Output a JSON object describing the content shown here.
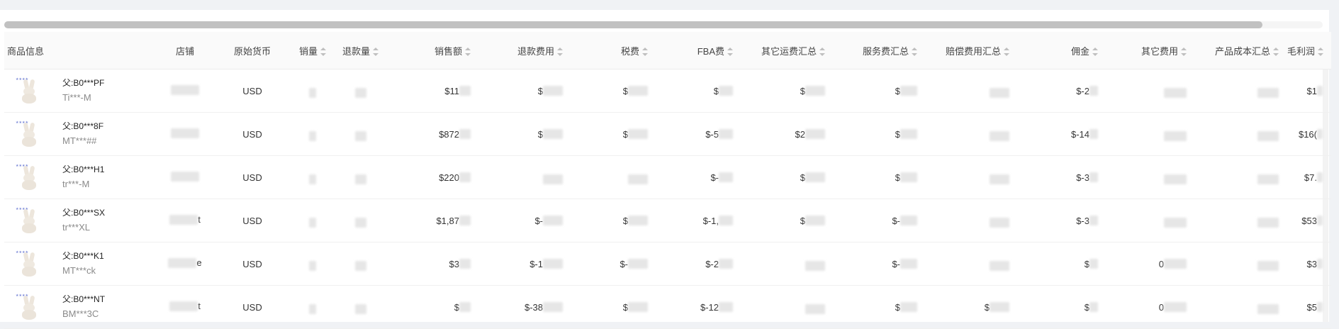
{
  "table": {
    "columns": [
      {
        "key": "product",
        "label": "商品信息",
        "align": "left",
        "sortable": false
      },
      {
        "key": "store",
        "label": "店铺",
        "align": "center",
        "sortable": false
      },
      {
        "key": "currency",
        "label": "原始货币",
        "align": "center",
        "sortable": false
      },
      {
        "key": "qty",
        "label": "销量",
        "align": "center",
        "sortable": true
      },
      {
        "key": "refund_qty",
        "label": "退款量",
        "align": "center",
        "sortable": true
      },
      {
        "key": "sales",
        "label": "销售额",
        "align": "right",
        "sortable": true
      },
      {
        "key": "refund_fee",
        "label": "退款费用",
        "align": "right",
        "sortable": true
      },
      {
        "key": "tax",
        "label": "税费",
        "align": "right",
        "sortable": true
      },
      {
        "key": "fba",
        "label": "FBA费",
        "align": "right",
        "sortable": true
      },
      {
        "key": "other_ship",
        "label": "其它运费汇总",
        "align": "right",
        "sortable": true
      },
      {
        "key": "service",
        "label": "服务费汇总",
        "align": "right",
        "sortable": true
      },
      {
        "key": "compensation",
        "label": "赔偿费用汇总",
        "align": "right",
        "sortable": true
      },
      {
        "key": "commission",
        "label": "佣金",
        "align": "right",
        "sortable": true
      },
      {
        "key": "other_fee",
        "label": "其它费用",
        "align": "right",
        "sortable": true
      },
      {
        "key": "cost",
        "label": "产品成本汇总",
        "align": "right",
        "sortable": true
      },
      {
        "key": "profit",
        "label": "毛利润",
        "align": "right",
        "sortable": true
      }
    ],
    "rows": [
      {
        "product": {
          "parent": "父:B0***PF",
          "sku": "Ti***-M"
        },
        "store": "",
        "currency": "USD",
        "qty": "",
        "refund_qty": "",
        "sales": "$11",
        "refund_fee": "$",
        "tax": "$",
        "fba": "$",
        "other_ship": "$",
        "service": "$",
        "compensation": "",
        "commission": "$-2",
        "other_fee": "",
        "cost": "",
        "profit": "$1"
      },
      {
        "product": {
          "parent": "父:B0***8F",
          "sku": "MT***##"
        },
        "store": "",
        "currency": "USD",
        "qty": "",
        "refund_qty": "",
        "sales": "$872",
        "refund_fee": "$",
        "tax": "$",
        "fba": "$-5",
        "other_ship": "$2",
        "service": "$",
        "compensation": "",
        "commission": "$-14",
        "other_fee": "",
        "cost": "",
        "profit": "$16("
      },
      {
        "product": {
          "parent": "父:B0***H1",
          "sku": "tr***-M"
        },
        "store": "",
        "currency": "USD",
        "qty": "",
        "refund_qty": "",
        "sales": "$220",
        "refund_fee": "",
        "tax": "",
        "fba": "$-",
        "other_ship": "$",
        "service": "$",
        "compensation": "",
        "commission": "$-3",
        "other_fee": "",
        "cost": "",
        "profit": "$7."
      },
      {
        "product": {
          "parent": "父:B0***SX",
          "sku": "tr***XL"
        },
        "store": "t",
        "currency": "USD",
        "qty": "",
        "refund_qty": "",
        "sales": "$1,87",
        "refund_fee": "$-",
        "tax": "$",
        "fba": "$-1,",
        "other_ship": "$",
        "service": "$-",
        "compensation": "",
        "commission": "$-3",
        "other_fee": "",
        "cost": "",
        "profit": "$53"
      },
      {
        "product": {
          "parent": "父:B0***K1",
          "sku": "MT***ck"
        },
        "store": "e",
        "currency": "USD",
        "qty": "",
        "refund_qty": "",
        "sales": "$3",
        "refund_fee": "$-1",
        "tax": "$-",
        "fba": "$-2",
        "other_ship": "",
        "service": "$-",
        "compensation": "",
        "commission": "$",
        "other_fee": "0",
        "cost": "",
        "profit": "$3"
      },
      {
        "product": {
          "parent": "父:B0***NT",
          "sku": "BM***3C"
        },
        "store": "t",
        "currency": "USD",
        "qty": "",
        "refund_qty": "",
        "sales": "$",
        "refund_fee": "$-38",
        "tax": "$",
        "fba": "$-12",
        "other_ship": "",
        "service": "$",
        "compensation": "$",
        "commission": "$",
        "other_fee": "0",
        "cost": "",
        "profit": "$5"
      }
    ]
  }
}
